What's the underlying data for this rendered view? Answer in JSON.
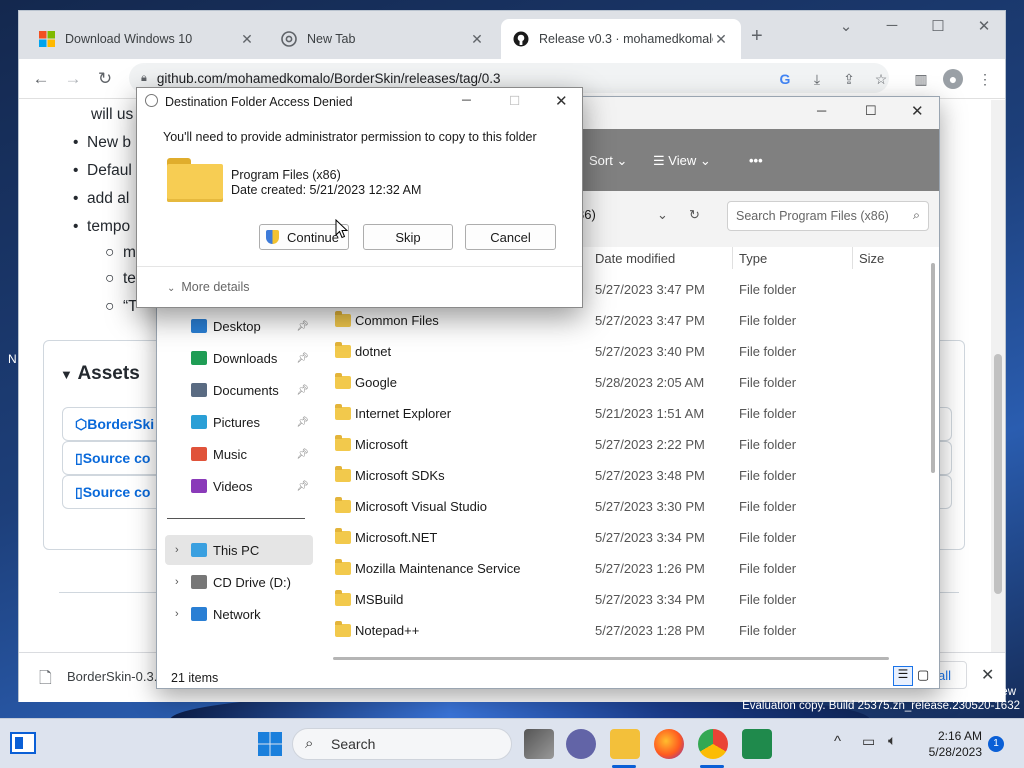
{
  "browser": {
    "tabs": [
      {
        "title": "Download Windows 10"
      },
      {
        "title": "New Tab"
      },
      {
        "title": "Release v0.3 · mohamedkomalo/"
      }
    ],
    "url": "github.com/mohamedkomalo/BorderSkin/releases/tag/0.3",
    "page": {
      "lines": [
        "will us",
        "New b",
        "Defaul",
        "add al",
        "tempo",
        "m",
        "te",
        "“T"
      ],
      "assets_heading": "Assets",
      "assets": [
        "BorderSki",
        "Source co",
        "Source co"
      ]
    },
    "download_item": "BorderSkin-0.3.:",
    "download_show_all": "all"
  },
  "explorer": {
    "commands": {
      "sort": "Sort",
      "view": "View"
    },
    "breadcrumb": "86)",
    "search_placeholder": "Search Program Files (x86)",
    "columns": {
      "date": "Date modified",
      "type": "Type",
      "size": "Size"
    },
    "nav": [
      {
        "label": "Desktop",
        "icon": "desktop-icon",
        "color": "#2a7fd4"
      },
      {
        "label": "Downloads",
        "icon": "downloads-icon",
        "color": "#1f9d55"
      },
      {
        "label": "Documents",
        "icon": "documents-icon",
        "color": "#5a6b82"
      },
      {
        "label": "Pictures",
        "icon": "pictures-icon",
        "color": "#2a9fd6"
      },
      {
        "label": "Music",
        "icon": "music-icon",
        "color": "#e0533a"
      },
      {
        "label": "Videos",
        "icon": "videos-icon",
        "color": "#8a3ab9"
      }
    ],
    "tree": [
      {
        "label": "This PC",
        "icon": "this-pc-icon"
      },
      {
        "label": "CD Drive (D:)",
        "icon": "cd-drive-icon"
      },
      {
        "label": "Network",
        "icon": "network-icon"
      }
    ],
    "rows": [
      {
        "name": "",
        "date": "5/27/2023 3:47 PM",
        "type": "File folder"
      },
      {
        "name": "Common Files",
        "date": "5/27/2023 3:47 PM",
        "type": "File folder"
      },
      {
        "name": "dotnet",
        "date": "5/27/2023 3:40 PM",
        "type": "File folder"
      },
      {
        "name": "Google",
        "date": "5/28/2023 2:05 AM",
        "type": "File folder"
      },
      {
        "name": "Internet Explorer",
        "date": "5/21/2023 1:51 AM",
        "type": "File folder"
      },
      {
        "name": "Microsoft",
        "date": "5/27/2023 2:22 PM",
        "type": "File folder"
      },
      {
        "name": "Microsoft SDKs",
        "date": "5/27/2023 3:48 PM",
        "type": "File folder"
      },
      {
        "name": "Microsoft Visual Studio",
        "date": "5/27/2023 3:30 PM",
        "type": "File folder"
      },
      {
        "name": "Microsoft.NET",
        "date": "5/27/2023 3:34 PM",
        "type": "File folder"
      },
      {
        "name": "Mozilla Maintenance Service",
        "date": "5/27/2023 1:26 PM",
        "type": "File folder"
      },
      {
        "name": "MSBuild",
        "date": "5/27/2023 3:34 PM",
        "type": "File folder"
      },
      {
        "name": "Notepad++",
        "date": "5/27/2023 1:28 PM",
        "type": "File folder"
      }
    ],
    "status": "21 items"
  },
  "dialog": {
    "title": "Destination Folder Access Denied",
    "message": "You'll need to provide administrator permission to copy to this folder",
    "folder_name": "Program Files (x86)",
    "date_created": "Date created: 5/21/2023 12:32 AM",
    "buttons": {
      "continue": "Continue",
      "skip": "Skip",
      "cancel": "Cancel"
    },
    "more_details": "More details"
  },
  "taskbar": {
    "search": "Search",
    "time": "2:16 AM",
    "date": "5/28/2023",
    "notification_count": "1"
  },
  "watermark": {
    "line1": "ew",
    "line2": "Evaluation copy. Build 25375.zn_release.230520-1632"
  },
  "desktop_label": "N"
}
